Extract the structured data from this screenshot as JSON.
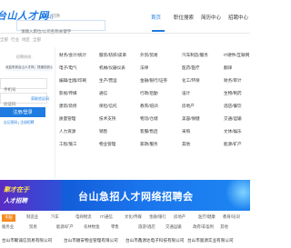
{
  "header": {
    "logo_text": "台山人才网",
    "city": "[台山]",
    "city_switch": "切换",
    "search_placeholder": "请输入职位/公司名称关键字",
    "nav": [
      {
        "label": "首页",
        "active": true
      },
      {
        "label": "职位搜索",
        "active": false
      },
      {
        "label": "简历中心",
        "active": false
      },
      {
        "label": "招聘中心",
        "active": false
      }
    ]
  },
  "breadcrumb": {
    "items": [
      "全部",
      "行业",
      "地区",
      "全部"
    ]
  },
  "login": {
    "hotline": "招聘热线：",
    "welcome": "欢迎来到台山人才网，快速找到心仪工作！",
    "phone_placeholder": "手机号",
    "code_placeholder": "验证码",
    "code_button": "获取验证码",
    "login_button": "注册/登录",
    "links": "忘记密码  |  注册招聘"
  },
  "categories": [
    [
      "财务/会计/统计",
      "服装/纺织/皮革",
      "外贸/贸易",
      "汽车制造/服务",
      "IT硬件/互联网"
    ],
    [
      "电子/电气",
      "机械/仪器仪表",
      "法律",
      "医药/医疗",
      "翻译"
    ],
    [
      "编辑/出版/印刷",
      "生产/营运",
      "金融/银行/证券",
      "化工/环保",
      "财务/审计"
    ],
    [
      "影视/传媒",
      "通信",
      "行政/后勤",
      "设计",
      "生物/制药"
    ],
    [
      "建筑/装修",
      "保险/信托",
      "教育/培训",
      "房地产",
      "酒店/餐饮"
    ],
    [
      "质量管理",
      "技术支持",
      "物流/仓储",
      "美容/保健",
      "交通/运输"
    ],
    [
      "人力资源",
      "销售",
      "客服/售后",
      "采购",
      "文体/娱乐"
    ],
    [
      "工程/施工",
      "物业管理",
      "家政/服务",
      "其他",
      "能源/矿产"
    ]
  ],
  "banner": {
    "tag_line1": "聚才在于",
    "tag_line2": "人才招聘",
    "title": "台山急招人才网络招聘会"
  },
  "filters_row1": [
    {
      "label": "不限",
      "active": true
    },
    {
      "label": "制造业",
      "active": false
    },
    {
      "label": "汽车",
      "active": false
    },
    {
      "label": "电商物流",
      "active": false
    },
    {
      "label": "IT/通信",
      "active": false
    },
    {
      "label": "文化/传媒",
      "active": false
    },
    {
      "label": "金融/银行",
      "active": false
    },
    {
      "label": "房地产",
      "active": false
    },
    {
      "label": "医疗/健康",
      "active": false
    },
    {
      "label": "教育/培训",
      "active": false
    }
  ],
  "filters_row2": [
    {
      "label": "服务业",
      "active": false
    },
    {
      "label": "贸易",
      "active": false
    },
    {
      "label": "能源/矿产",
      "active": false
    },
    {
      "label": "农林牧渔",
      "active": false
    },
    {
      "label": "零售",
      "active": false
    },
    {
      "label": "旅游/酒店",
      "active": false
    },
    {
      "label": "交通运输",
      "active": false
    },
    {
      "label": "政府/非盈利",
      "active": false
    },
    {
      "label": "其他",
      "active": false
    }
  ],
  "companies": [
    "台山市聚诚信贸易有限公司",
    "台山市顺安物业管理有限公司",
    "台山市鑫源达电子科技有限公司",
    "台山市富源实业有限公司"
  ],
  "colors": {
    "accent": "#1e7be0",
    "banner": "#1a74ec",
    "filter_active": "#f58a1f"
  }
}
